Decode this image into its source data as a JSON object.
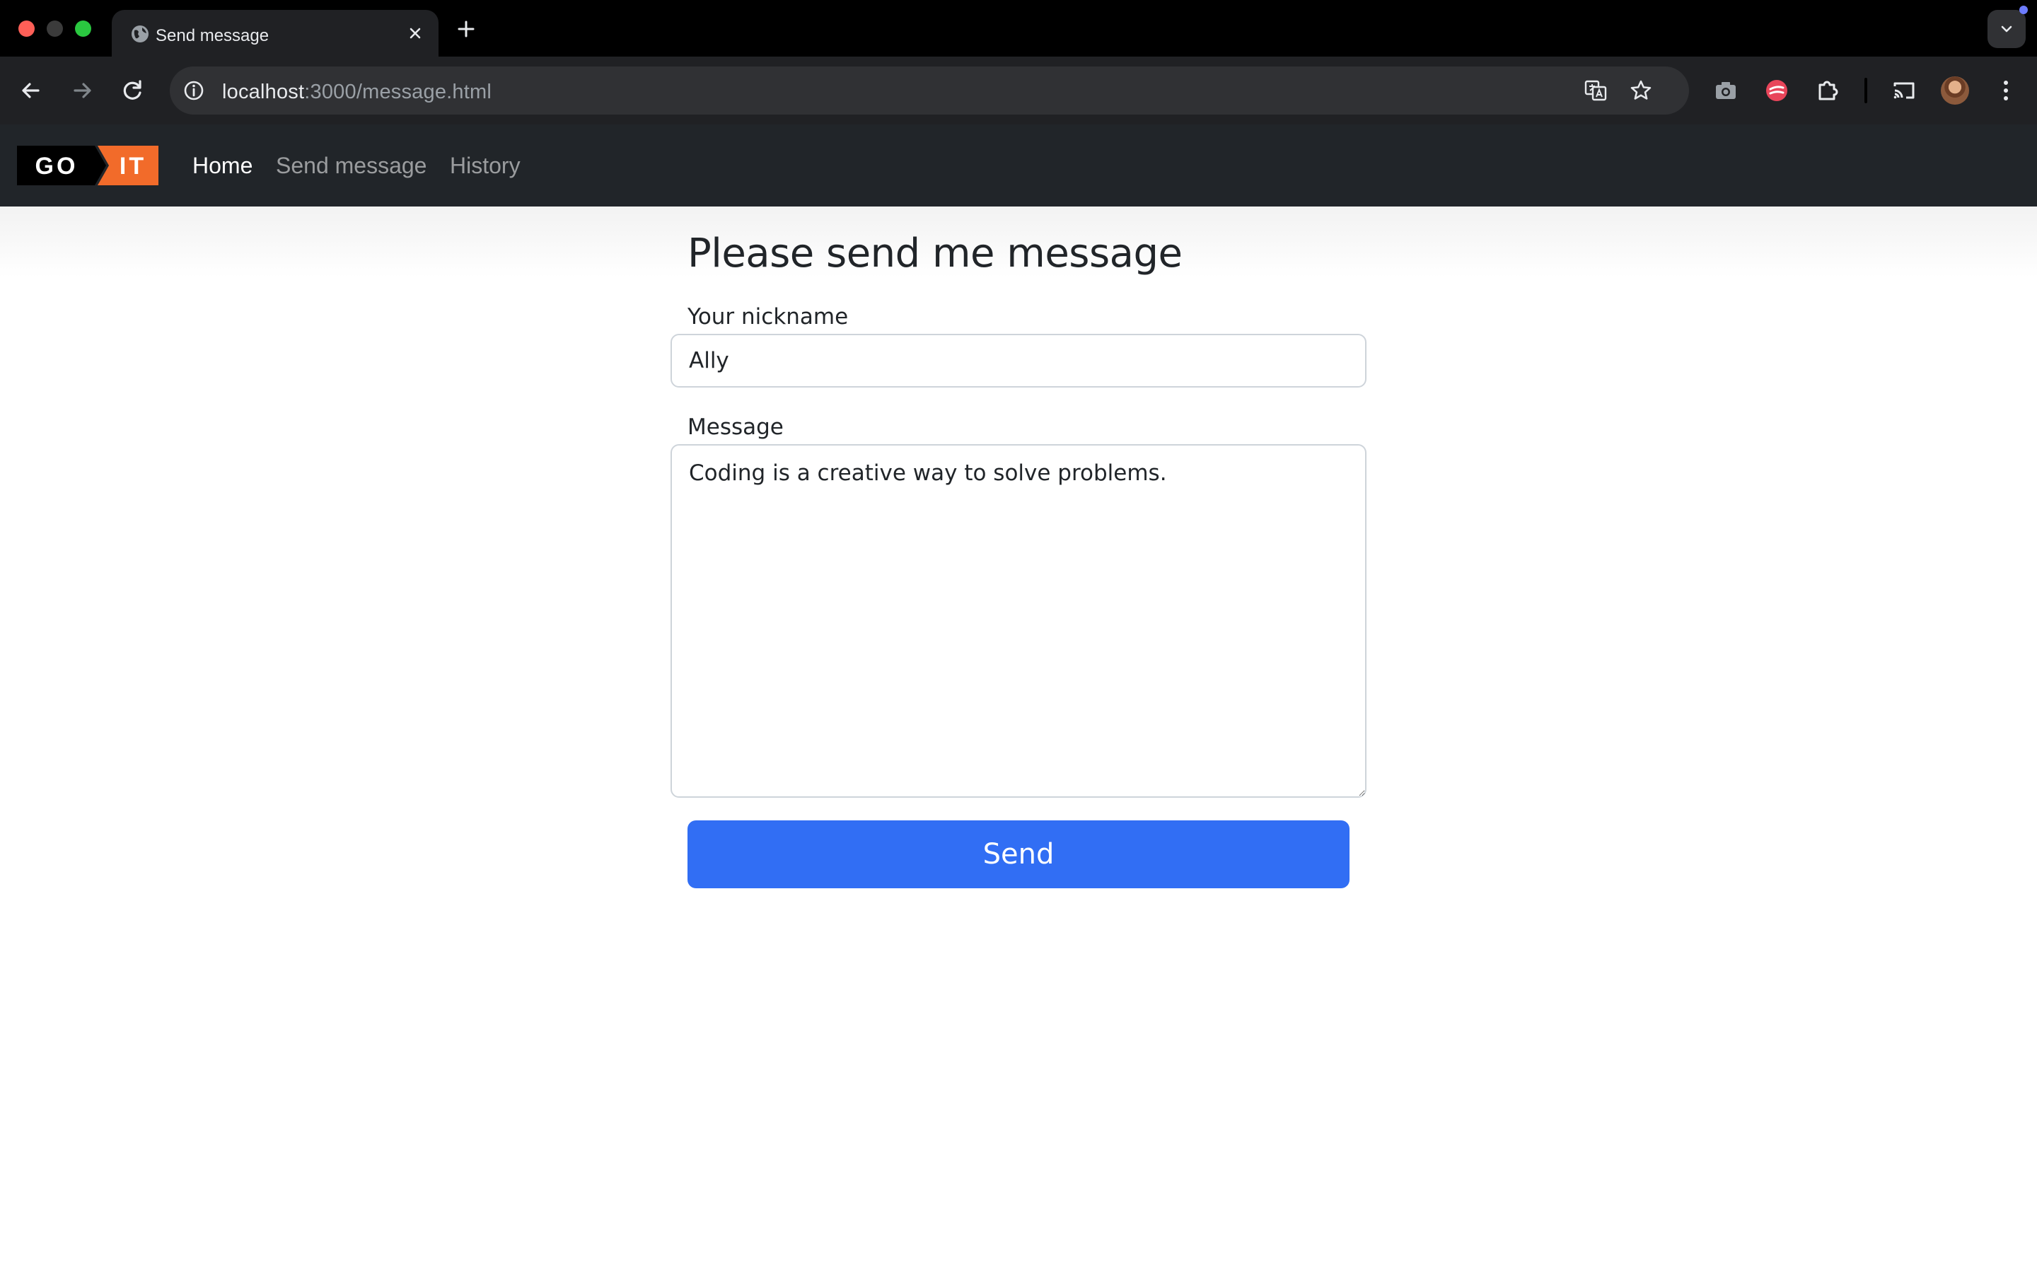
{
  "browser": {
    "tab": {
      "title": "Send message"
    },
    "address": {
      "host": "localhost",
      "rest": ":3000/message.html"
    }
  },
  "navbar": {
    "logo": {
      "left": "GO",
      "right": "IT"
    },
    "links": [
      {
        "label": "Home",
        "active": true
      },
      {
        "label": "Send message",
        "active": false
      },
      {
        "label": "History",
        "active": false
      }
    ]
  },
  "form": {
    "heading": "Please send me message",
    "nickname_label": "Your nickname",
    "nickname_value": "Ally",
    "message_label": "Message",
    "message_value": "Coding is a creative way to solve problems.",
    "submit_label": "Send"
  },
  "colors": {
    "primary": "#316ef4",
    "navbar_bg": "#212529",
    "logo_orange": "#f26b2a"
  }
}
